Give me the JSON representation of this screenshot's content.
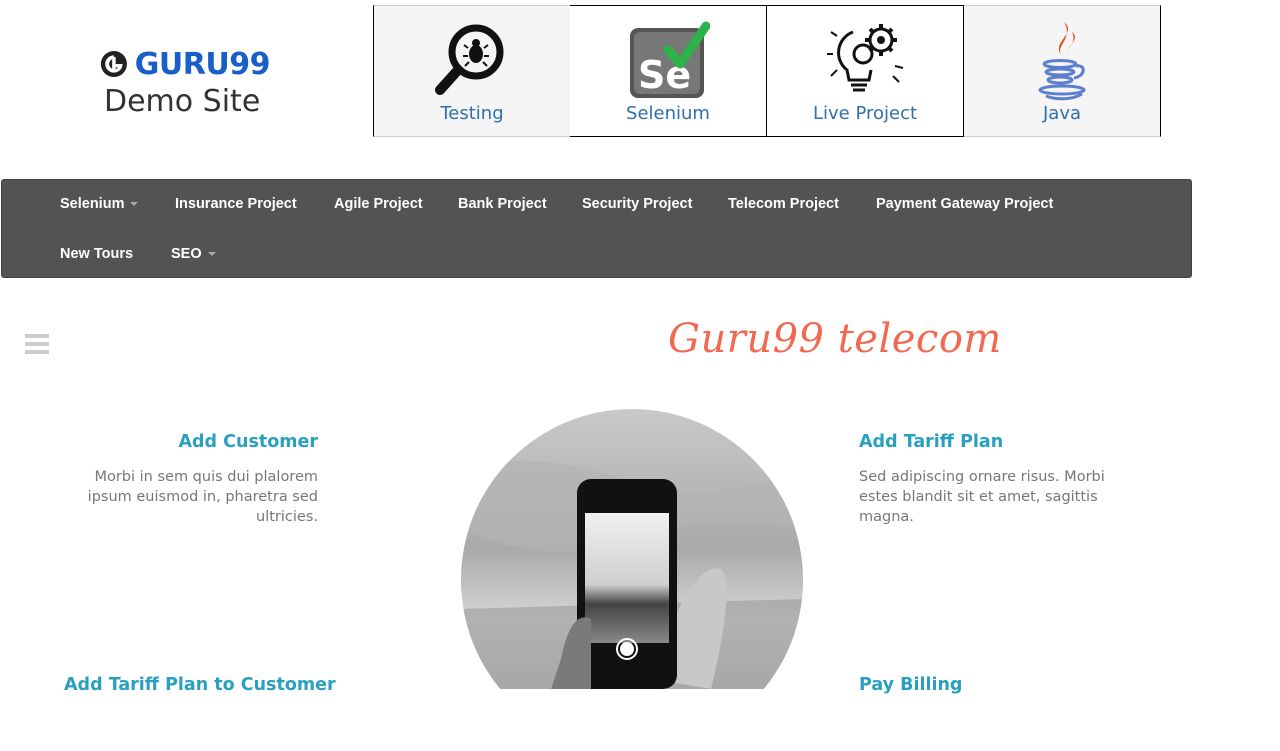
{
  "logo": {
    "brand": "GURU99",
    "subtitle": "Demo Site"
  },
  "tiles": [
    {
      "label": "Testing",
      "icon": "magnifier-bug-icon"
    },
    {
      "label": "Selenium",
      "icon": "selenium-icon"
    },
    {
      "label": "Live Project",
      "icon": "lightbulb-gear-icon"
    },
    {
      "label": "Java",
      "icon": "java-icon"
    }
  ],
  "nav": {
    "items": [
      {
        "label": "Selenium",
        "dropdown": true
      },
      {
        "label": "Insurance Project"
      },
      {
        "label": "Agile Project"
      },
      {
        "label": "Bank Project"
      },
      {
        "label": "Security Project"
      },
      {
        "label": "Telecom Project"
      },
      {
        "label": "Payment Gateway Project"
      },
      {
        "label": "New Tours"
      },
      {
        "label": "SEO",
        "dropdown": true
      }
    ]
  },
  "brand_title": "Guru99 telecom",
  "features": {
    "add_customer": {
      "title": "Add Customer",
      "text": "Morbi in sem quis dui plalorem ipsum euismod in, pharetra sed ultricies."
    },
    "add_tariff_plan": {
      "title": "Add Tariff Plan",
      "text": "Sed adipiscing ornare risus. Morbi estes blandit sit et amet, sagittis magna."
    },
    "add_tariff_plan_to_customer": {
      "title": "Add Tariff Plan to Customer"
    },
    "pay_billing": {
      "title": "Pay Billing"
    }
  },
  "colors": {
    "nav_bg": "#535353",
    "brand": "#f06a52",
    "feature_title": "#2aa0c0",
    "tile_label": "#2f6fab",
    "logo": "#1a5ec8"
  }
}
